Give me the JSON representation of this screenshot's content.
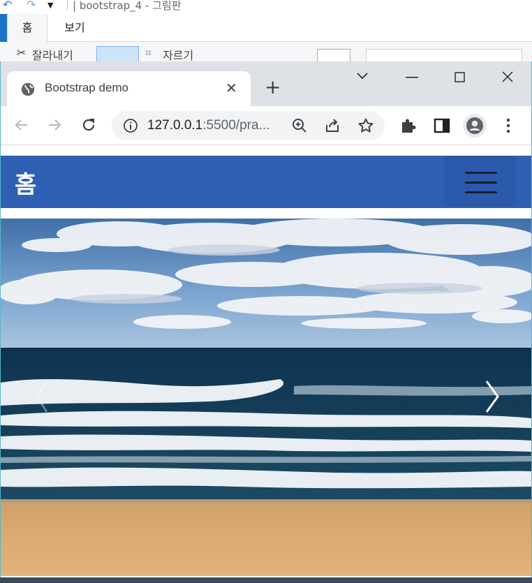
{
  "paint": {
    "title": "| bootstrap_4 - 그림판",
    "tabs": {
      "home": "홈",
      "view": "보기"
    },
    "ribbon": {
      "cut": "잘라내기",
      "crop": "자르기"
    }
  },
  "browser": {
    "tab": {
      "title": "Bootstrap demo",
      "close": "✕"
    },
    "new_tab": "+",
    "url": {
      "host": "127.0.0.1",
      "rest": ":5500/pra..."
    }
  },
  "page": {
    "navbar": {
      "brand": "홈"
    },
    "carousel": {
      "image": "beach-ocean-photo"
    }
  },
  "colors": {
    "navbar": "#2f5fb3",
    "tabstrip": "#dee1e6",
    "window_border": "#59b7c8"
  }
}
